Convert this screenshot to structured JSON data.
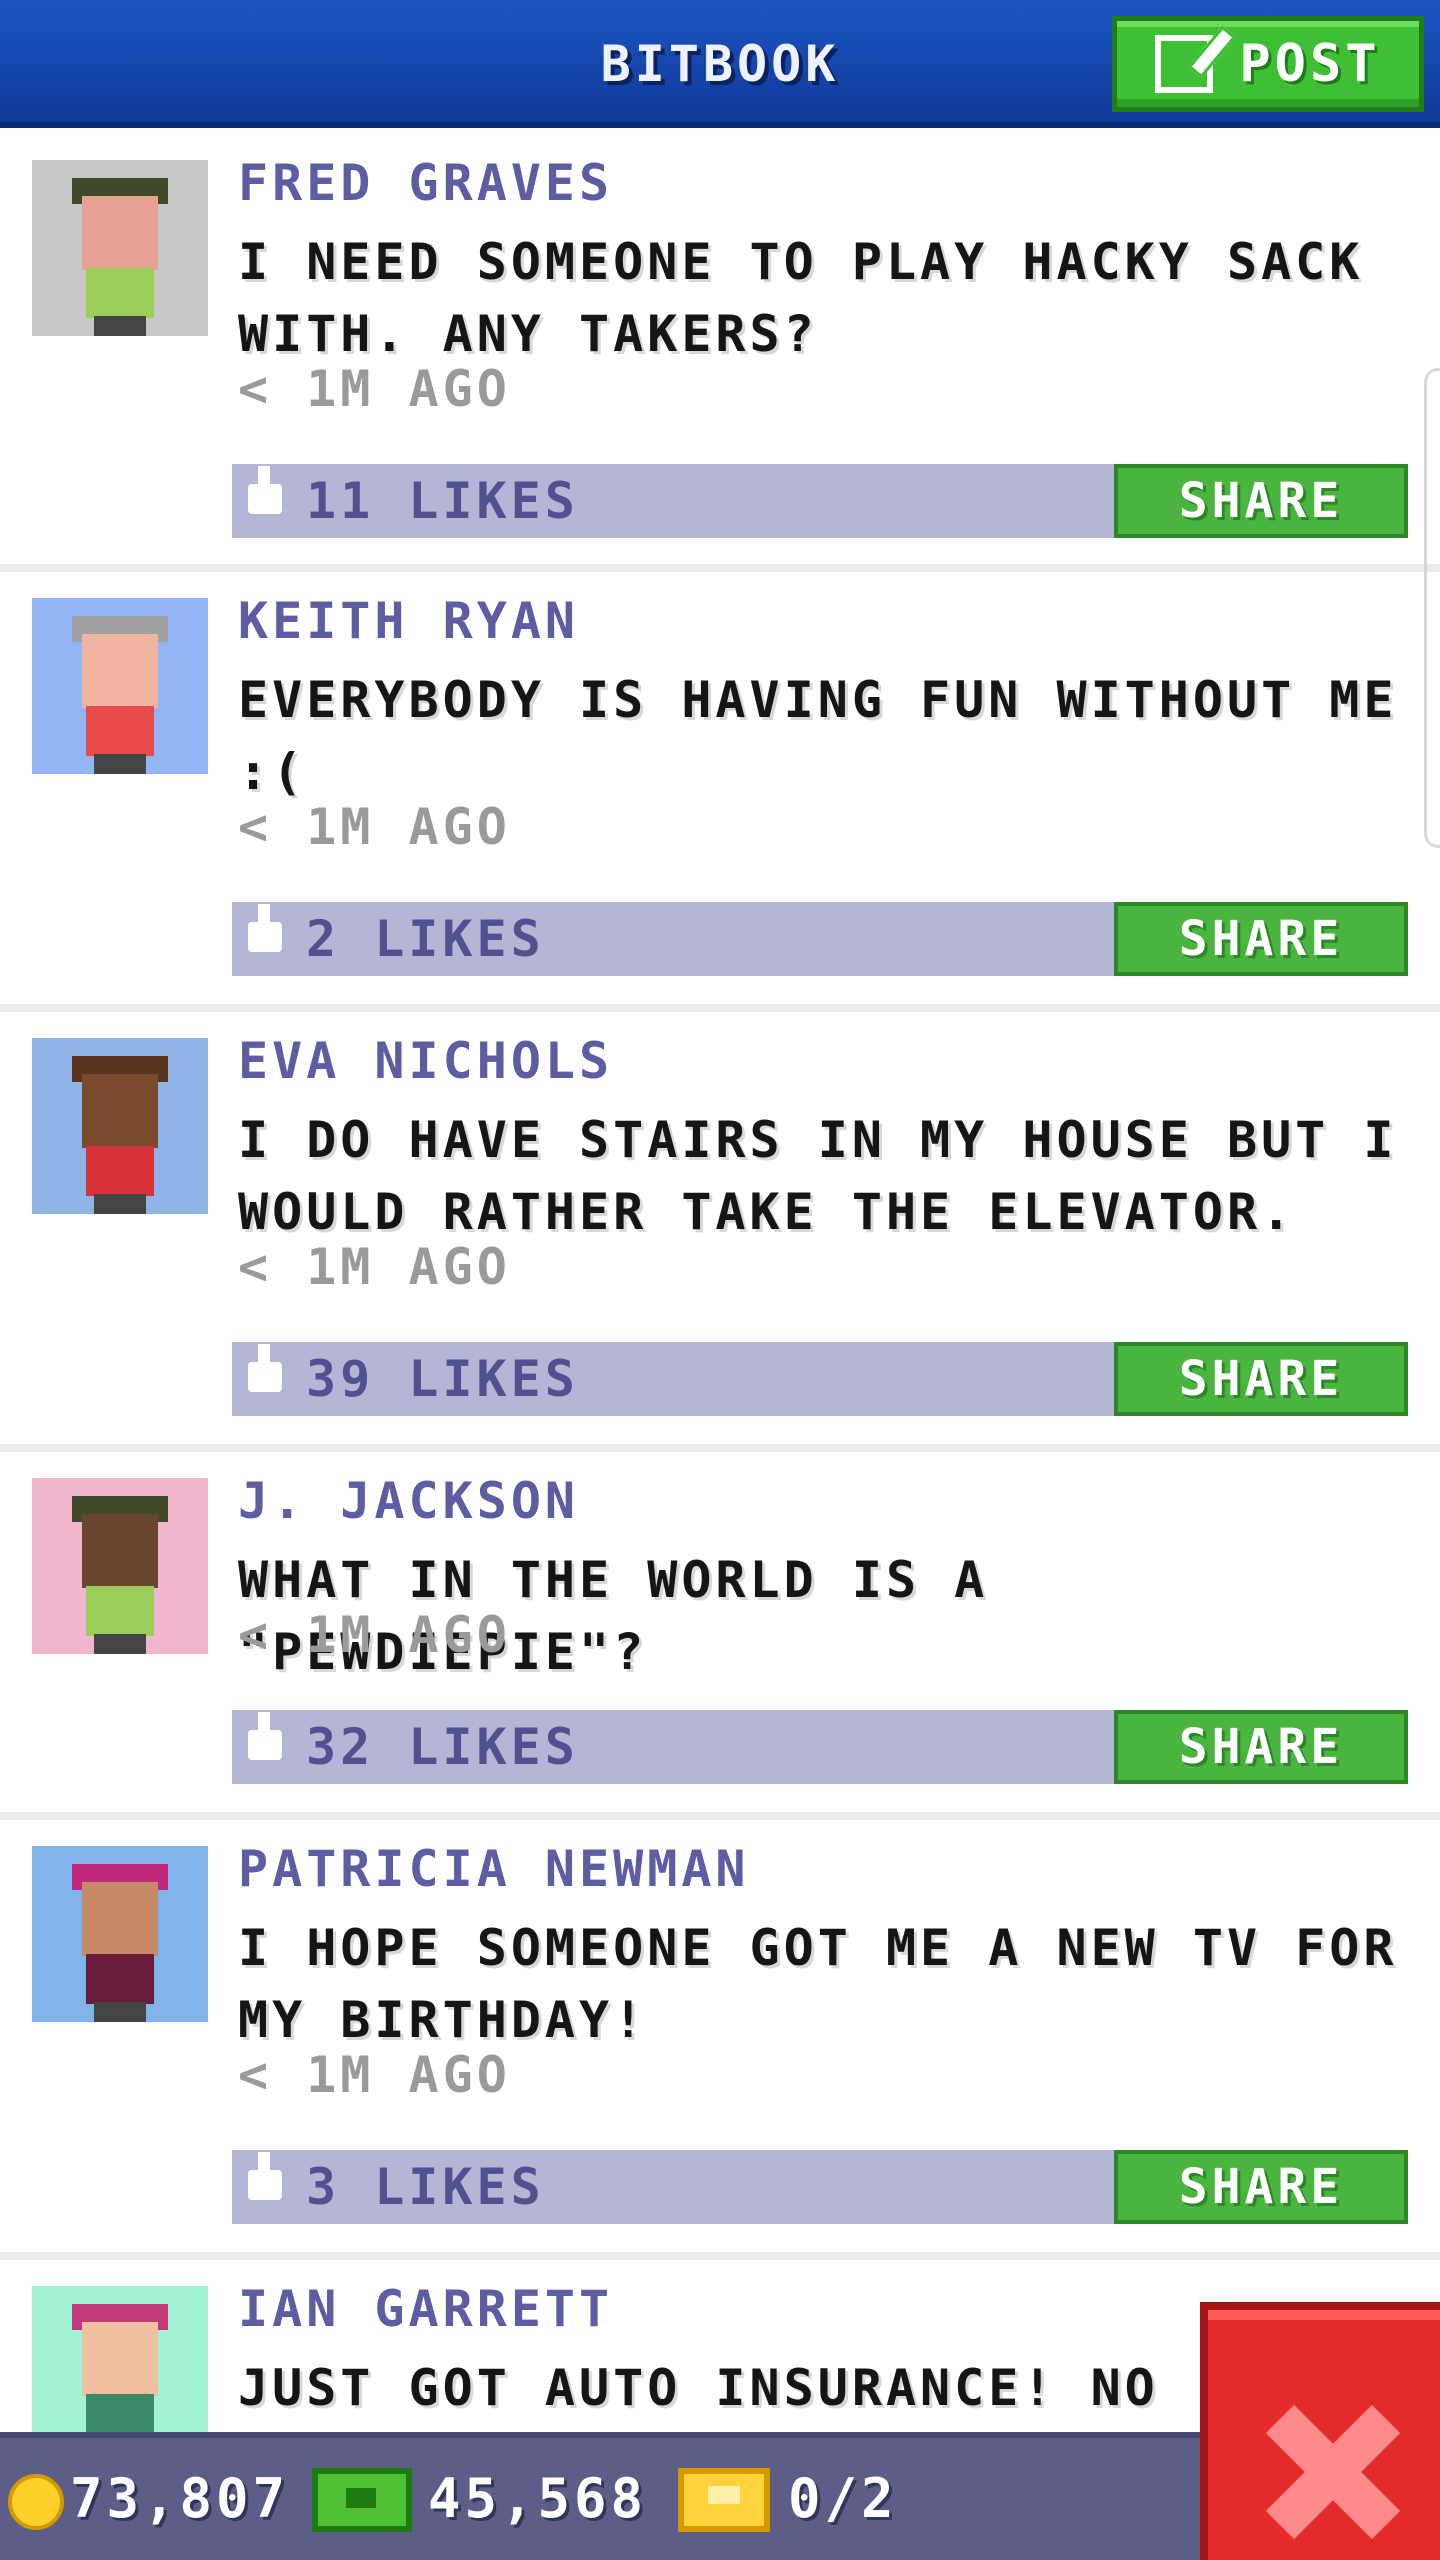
{
  "header": {
    "title": "BITBOOK",
    "post_label": "POST",
    "post_icon": "compose-icon"
  },
  "colors": {
    "header_blue": "#1b56c2",
    "post_green": "#3fbf34",
    "name_purple": "#5c5da3",
    "like_bar": "#b4b6d6",
    "share_green": "#49b53e",
    "bottom_bar": "#5d5e87",
    "close_red": "#e52a2a"
  },
  "posts": [
    {
      "name": "FRED GRAVES",
      "message": "I NEED SOMEONE TO PLAY HACKY SACK WITH. ANY TAKERS?",
      "time": "< 1M AGO",
      "likes": "11 LIKES",
      "share": "SHARE",
      "avatar_bg": "#c8c8c8",
      "skin": "#e8a293",
      "hat": "#3f4a2a",
      "shirt": "#9acd5a"
    },
    {
      "name": "KEITH RYAN",
      "message": "EVERYBODY IS HAVING FUN WITHOUT ME :(",
      "time": "< 1M AGO",
      "likes": "2 LIKES",
      "share": "SHARE",
      "avatar_bg": "#93b4f6",
      "skin": "#f0b5a0",
      "hat": "#a0a0a0",
      "shirt": "#e84a4a"
    },
    {
      "name": "EVA NICHOLS",
      "message": "I DO HAVE STAIRS IN MY HOUSE BUT I WOULD RATHER TAKE THE ELEVATOR.",
      "time": "< 1M AGO",
      "likes": "39 LIKES",
      "share": "SHARE",
      "avatar_bg": "#8fb4e6",
      "skin": "#7a4a2e",
      "hat": "#5a3420",
      "shirt": "#d8323a"
    },
    {
      "name": "J. JACKSON",
      "message": "WHAT IN THE WORLD IS A \"PEWDIEPIE\"?",
      "time": "< 1M AGO",
      "likes": "32 LIKES",
      "share": "SHARE",
      "avatar_bg": "#f3b6cf",
      "skin": "#6a4530",
      "hat": "#3f4a2a",
      "shirt": "#9acd5a"
    },
    {
      "name": "PATRICIA NEWMAN",
      "message": "I HOPE SOMEONE GOT ME A NEW TV FOR MY BIRTHDAY!",
      "time": "< 1M AGO",
      "likes": "3 LIKES",
      "share": "SHARE",
      "avatar_bg": "#7fb3ea",
      "skin": "#c58a68",
      "hat": "#c0287c",
      "shirt": "#6a1a3a"
    },
    {
      "name": "IAN GARRETT",
      "message": "JUST GOT AUTO INSURANCE! NO",
      "time": "",
      "likes": "",
      "share": "",
      "avatar_bg": "#a2f3d3",
      "skin": "#f0c0a0",
      "hat": "#c03a7a",
      "shirt": "#3a8a6a"
    }
  ],
  "bottom_bar": {
    "coins": "73,807",
    "coin_icon": "coin-icon",
    "bux": "45,568",
    "bux_icon": "cash-icon",
    "tickets": "0/2",
    "ticket_icon": "ticket-icon"
  },
  "close": {
    "icon": "close-icon"
  }
}
